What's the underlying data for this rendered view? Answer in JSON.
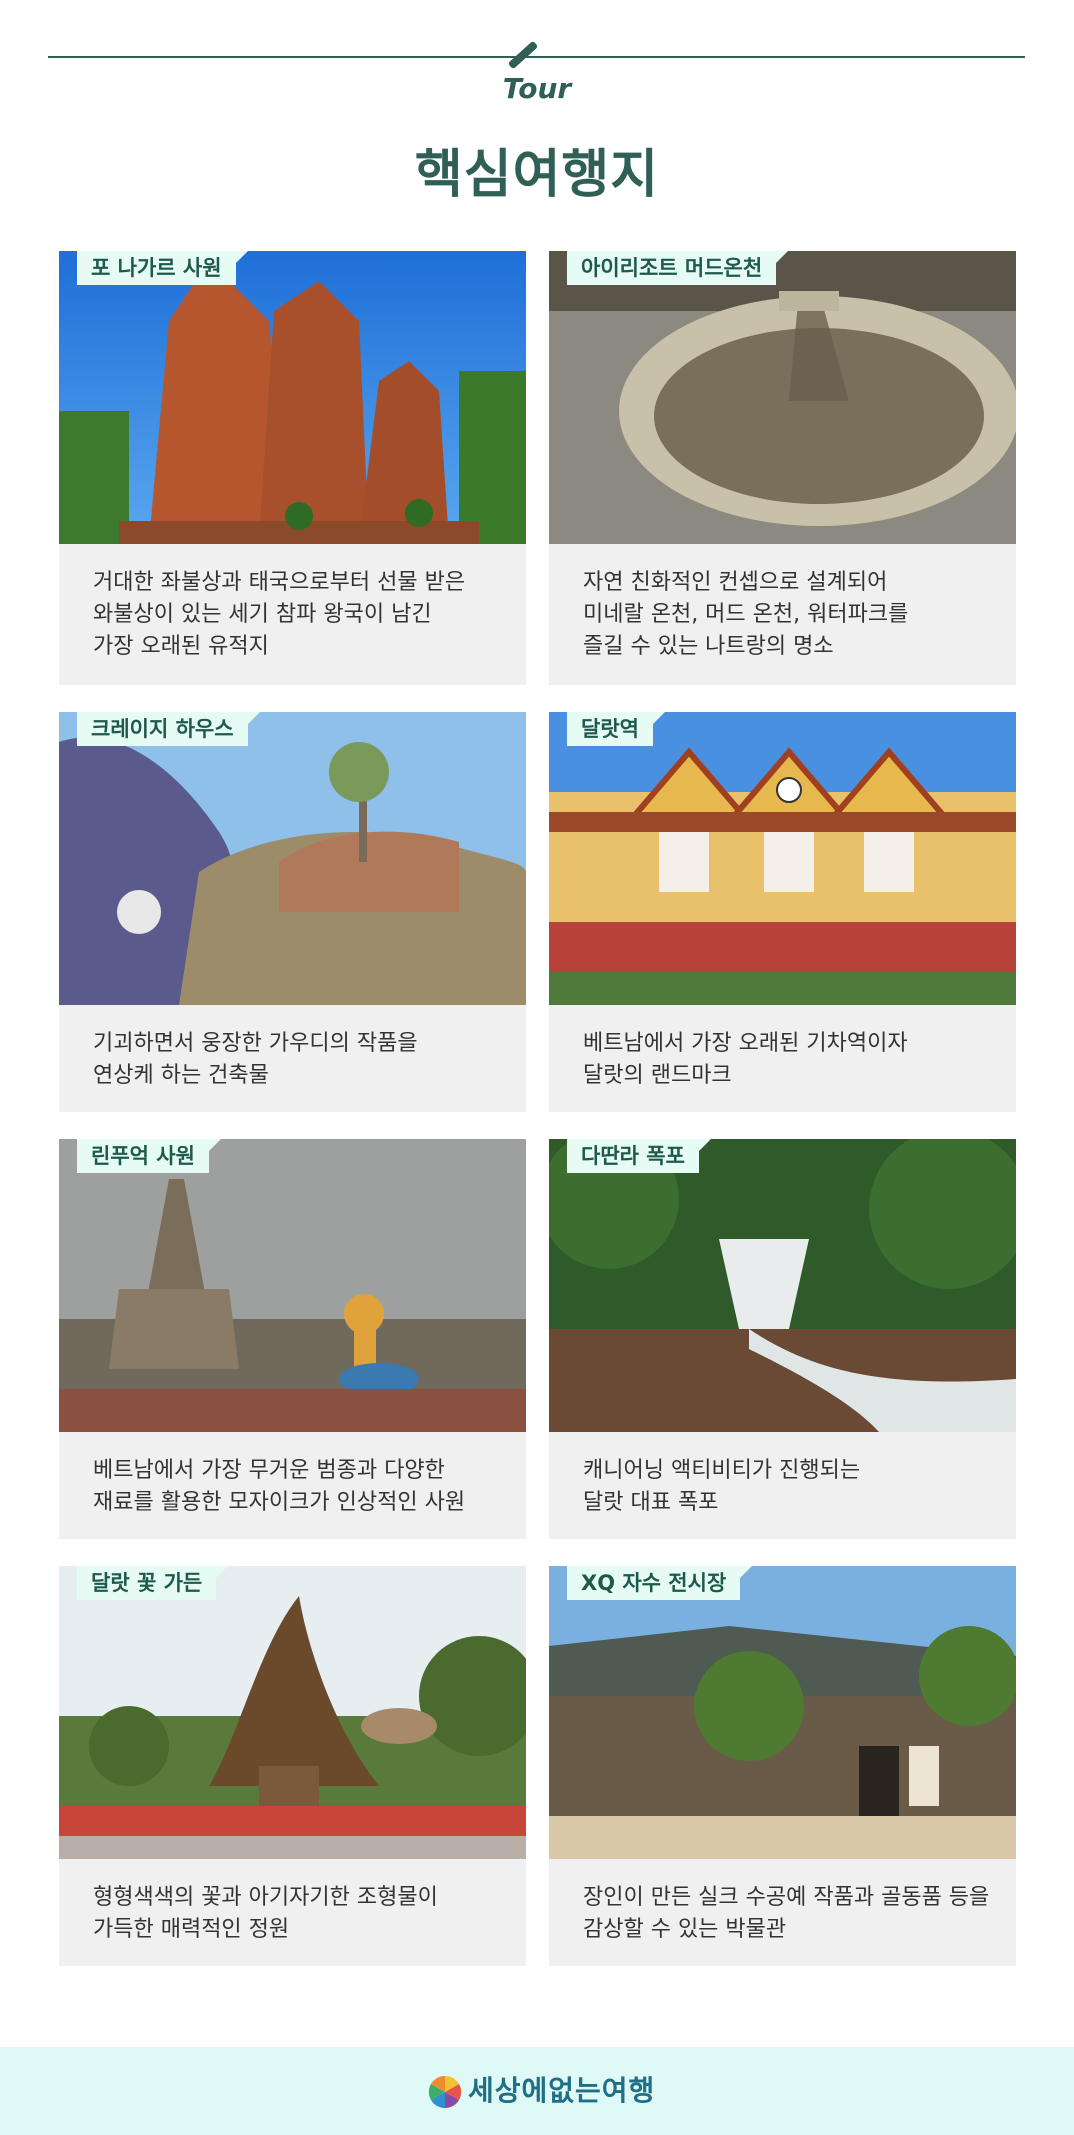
{
  "header": {
    "subtitle": "Tour",
    "title": "핵심여행지"
  },
  "cards": [
    {
      "tag": "포 나가르 사원",
      "lines": [
        "거대한 좌불상과 태국으로부터 선물 받은",
        "와불상이 있는 세기 참파 왕국이 남긴",
        "가장 오래된 유적지"
      ]
    },
    {
      "tag": "아이리조트 머드온천",
      "lines": [
        "자연 친화적인 컨셉으로 설계되어",
        "미네랄 온천, 머드 온천, 워터파크를",
        "즐길 수 있는 나트랑의 명소"
      ]
    },
    {
      "tag": "크레이지 하우스",
      "lines": [
        "기괴하면서 웅장한 가우디의 작품을",
        "연상케 하는 건축물"
      ]
    },
    {
      "tag": "달랏역",
      "lines": [
        "베트남에서 가장 오래된 기차역이자",
        "달랏의 랜드마크"
      ]
    },
    {
      "tag": "린푸억 사원",
      "lines": [
        "베트남에서 가장 무거운 범종과 다양한",
        "재료를 활용한 모자이크가 인상적인 사원"
      ]
    },
    {
      "tag": "다딴라 폭포",
      "lines": [
        "캐니어닝 액티비티가 진행되는",
        "달랏 대표 폭포"
      ]
    },
    {
      "tag": "달랏 꽃 가든",
      "lines": [
        "형형색색의 꽃과 아기자기한 조형물이",
        "가득한 매력적인 정원"
      ]
    },
    {
      "tag": "XQ 자수 전시장",
      "lines": [
        "장인이 만든 실크 수공예 작품과 골동품 등을",
        "감상할 수 있는 박물관"
      ]
    }
  ],
  "footer": {
    "brand": "세상에없는여행",
    "logo_icon": "colorful-circle-logo-icon"
  },
  "colors": {
    "accent": "#2f5f55",
    "tag_bg": "#e6fbf4",
    "card_bg": "#f0f0f0",
    "footer_bg": "#dff9f6"
  }
}
